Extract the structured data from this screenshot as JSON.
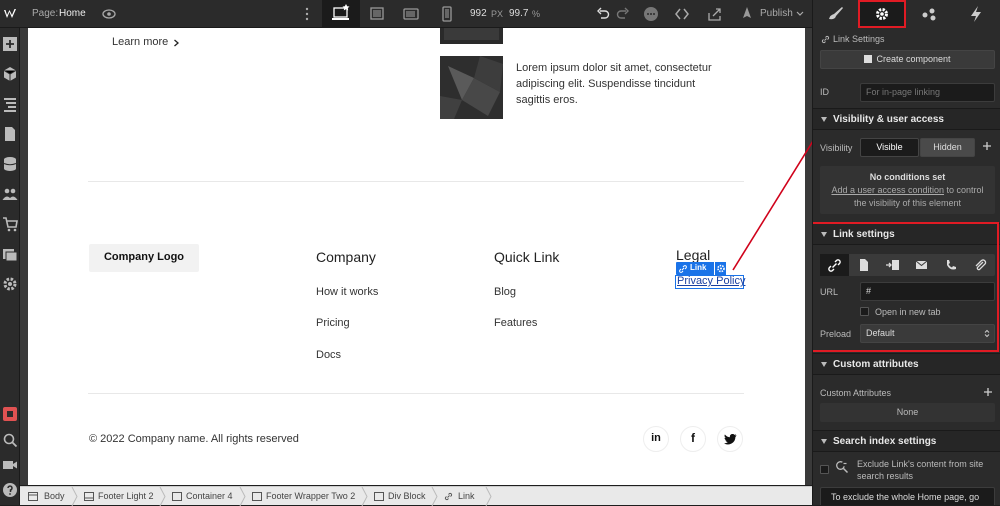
{
  "topbar": {
    "page_label": "Page:",
    "page_name": "Home",
    "width_value": "992",
    "width_unit": "PX",
    "zoom": "99.7",
    "zoom_unit": "%",
    "publish": "Publish"
  },
  "canvas": {
    "learn_more": "Learn more",
    "article_text": [
      "Lorem ipsum dolor sit amet, consectetur",
      "adipiscing elit. Suspendisse tincidunt",
      "sagittis eros."
    ],
    "logo": "Company Logo",
    "columns": [
      {
        "heading": "Company",
        "links": [
          "How it works",
          "Pricing",
          "Docs"
        ]
      },
      {
        "heading": "Quick Link",
        "links": [
          "Blog",
          "Features"
        ]
      }
    ],
    "legal": {
      "heading": "Legal",
      "link_badge": "Link",
      "link": "Privacy Policy"
    },
    "copyright": "© 2022 Company name. All rights reserved",
    "social": [
      "in",
      "f"
    ]
  },
  "breadcrumbs": [
    "Body",
    "Footer Light 2",
    "Container 4",
    "Footer Wrapper Two 2",
    "Div Block",
    "Link"
  ],
  "panel": {
    "element_title": "Link Settings",
    "create_component": "Create component",
    "id_label": "ID",
    "id_placeholder": "For in-page linking",
    "visibility_section": "Visibility & user access",
    "visibility_label": "Visibility",
    "visible": "Visible",
    "hidden": "Hidden",
    "no_conditions": "No conditions set",
    "conditions_help_link": "Add a user access condition",
    "conditions_help_rest": " to control",
    "conditions_help_line2": "the visibility of this element",
    "link_section": "Link settings",
    "url_label": "URL",
    "url_value": "#",
    "open_new_tab": "Open in new tab",
    "preload_label": "Preload",
    "preload_value": "Default",
    "custom_attr_section": "Custom attributes",
    "custom_attr_label": "Custom Attributes",
    "custom_attr_value": "None",
    "search_section": "Search index settings",
    "search_exclude_line1": "Exclude Link's content from site",
    "search_exclude_line2": "search results",
    "search_note": "To exclude the whole Home page, go"
  },
  "colors": {
    "accent_blue": "#1a73e8",
    "highlight_red": "#e01b24",
    "panel_bg": "#2b2b2b"
  }
}
